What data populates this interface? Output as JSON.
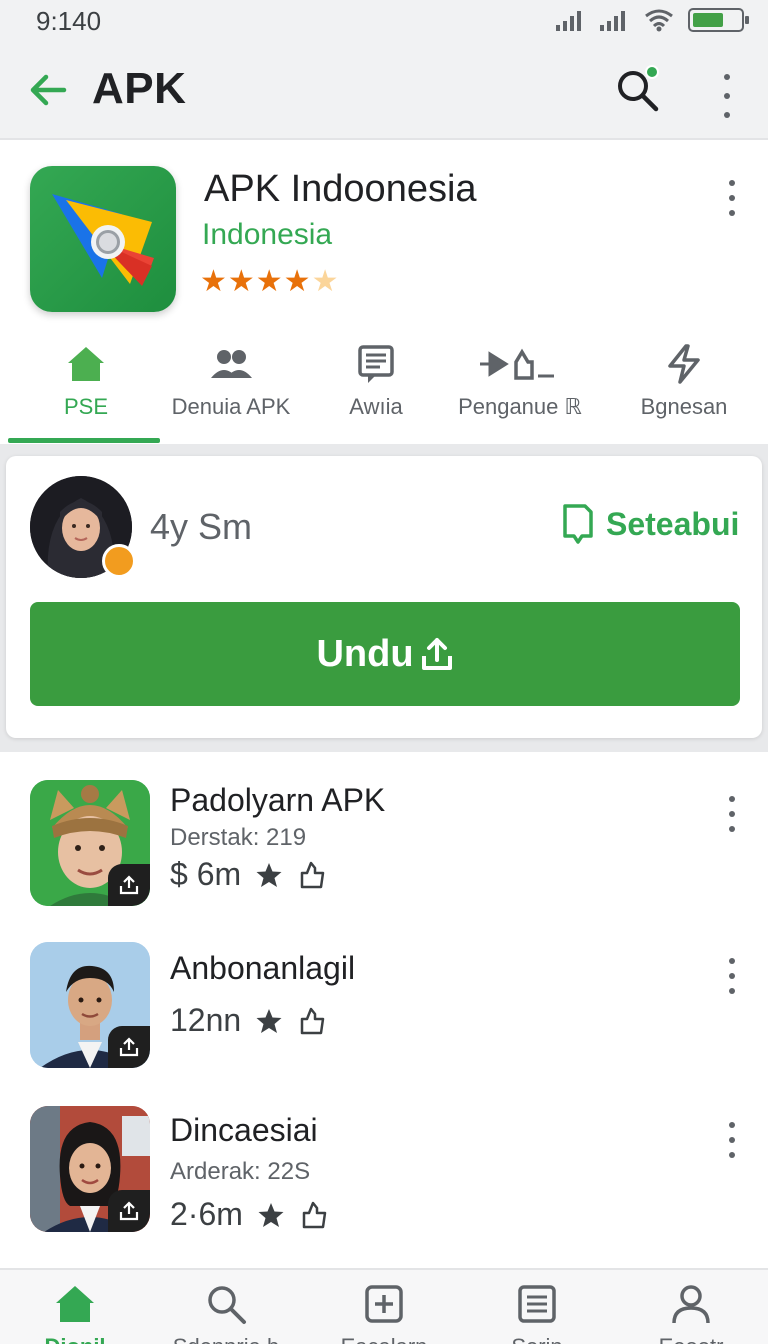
{
  "status_bar": {
    "time": "9:140"
  },
  "app_bar": {
    "title": "APK",
    "back_icon": "arrow-back-icon",
    "search_icon": "search-icon",
    "more_icon": "more-vert-icon"
  },
  "app": {
    "name": "APK Indoonesia",
    "developer": "Indonesia",
    "rating": 4.5,
    "stars_full": "★★★★",
    "stars_half": "★"
  },
  "tabs": [
    {
      "label": "PSE",
      "icon": "home-icon",
      "active": true
    },
    {
      "label": "Denuia APK",
      "icon": "people-icon",
      "active": false
    },
    {
      "label": "Awıia",
      "icon": "document-icon",
      "active": false
    },
    {
      "label": "Penganue ℝ",
      "icon": "share-icon",
      "active": false
    },
    {
      "label": "Bgnesan",
      "icon": "bolt-icon",
      "active": false
    }
  ],
  "featured": {
    "time": "4y Sm",
    "save_label": "Seteabui",
    "download_label": "Undu"
  },
  "list": [
    {
      "title": "Padolyarn APK",
      "subtitle": "Derstak: 219",
      "meta": "$ 6m"
    },
    {
      "title": "Anbonanlagil",
      "subtitle": "",
      "meta": "12nn"
    },
    {
      "title": "Dincaesiai",
      "subtitle": "Arderak: 22S",
      "meta": "2·6m"
    }
  ],
  "bottom_nav": [
    {
      "label": "Dionil",
      "icon": "home-icon",
      "active": true
    },
    {
      "label": "Sdenpria b",
      "icon": "search-icon",
      "active": false
    },
    {
      "label": "Eacalarn",
      "icon": "add-box-icon",
      "active": false
    },
    {
      "label": "Serin",
      "icon": "list-icon",
      "active": false
    },
    {
      "label": "Eeootr",
      "icon": "person-icon",
      "active": false
    }
  ],
  "colors": {
    "accent": "#34a853",
    "button": "#3a9c3f",
    "star": "#e8710a"
  }
}
